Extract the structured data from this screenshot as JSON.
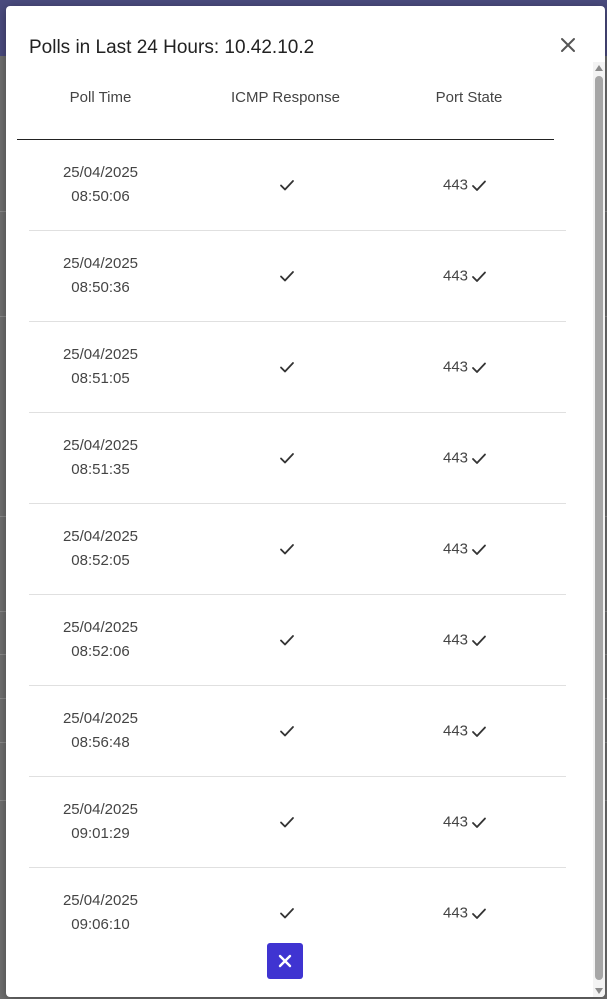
{
  "dialog": {
    "title": "Polls in Last 24 Hours: 10.42.10.2",
    "columns": [
      "Poll Time",
      "ICMP Response",
      "Port State"
    ],
    "rows": [
      {
        "date": "25/04/2025",
        "time": "08:50:06",
        "icmp": "ok",
        "port": "443",
        "port_state": "ok"
      },
      {
        "date": "25/04/2025",
        "time": "08:50:36",
        "icmp": "ok",
        "port": "443",
        "port_state": "ok"
      },
      {
        "date": "25/04/2025",
        "time": "08:51:05",
        "icmp": "ok",
        "port": "443",
        "port_state": "ok"
      },
      {
        "date": "25/04/2025",
        "time": "08:51:35",
        "icmp": "ok",
        "port": "443",
        "port_state": "ok"
      },
      {
        "date": "25/04/2025",
        "time": "08:52:05",
        "icmp": "ok",
        "port": "443",
        "port_state": "ok"
      },
      {
        "date": "25/04/2025",
        "time": "08:52:06",
        "icmp": "ok",
        "port": "443",
        "port_state": "ok"
      },
      {
        "date": "25/04/2025",
        "time": "08:56:48",
        "icmp": "ok",
        "port": "443",
        "port_state": "ok"
      },
      {
        "date": "25/04/2025",
        "time": "09:01:29",
        "icmp": "ok",
        "port": "443",
        "port_state": "ok"
      },
      {
        "date": "25/04/2025",
        "time": "09:06:10",
        "icmp": "ok",
        "port": "443",
        "port_state": "ok"
      }
    ],
    "icons": {
      "close": "close-icon",
      "check": "check-icon",
      "bottom_close": "close-icon"
    },
    "colors": {
      "primary_button": "#3f34d1",
      "header_rule": "#222222",
      "row_divider": "#e0e0e0"
    }
  }
}
